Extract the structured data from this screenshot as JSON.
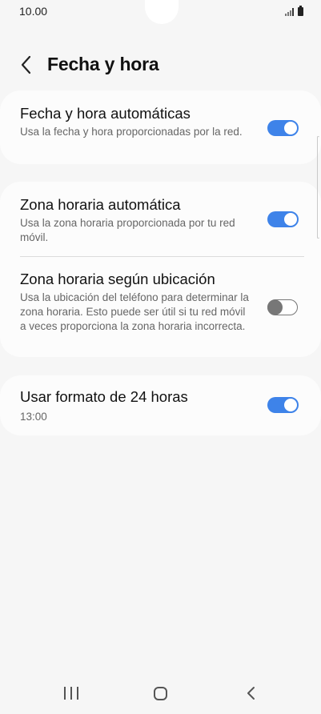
{
  "status_bar": {
    "time": "10.00"
  },
  "header": {
    "title": "Fecha y hora"
  },
  "settings": {
    "auto_datetime": {
      "title": "Fecha y hora automáticas",
      "subtitle": "Usa la fecha y hora proporcionadas por la red.",
      "enabled": true
    },
    "auto_timezone": {
      "title": "Zona horaria automática",
      "subtitle": "Usa la zona horaria proporcionada por tu red móvil.",
      "enabled": true
    },
    "location_timezone": {
      "title": "Zona horaria según ubicación",
      "subtitle": "Usa la ubicación del teléfono para determinar la zona horaria. Esto puede ser útil si tu red móvil a veces proporciona la zona horaria incorrecta.",
      "enabled": false
    },
    "format_24h": {
      "title": "Usar formato de 24 horas",
      "subtitle": "13:00",
      "enabled": true
    }
  },
  "colors": {
    "accent": "#3e83e9",
    "background": "#f6f6f6",
    "card": "#fcfcfc"
  }
}
